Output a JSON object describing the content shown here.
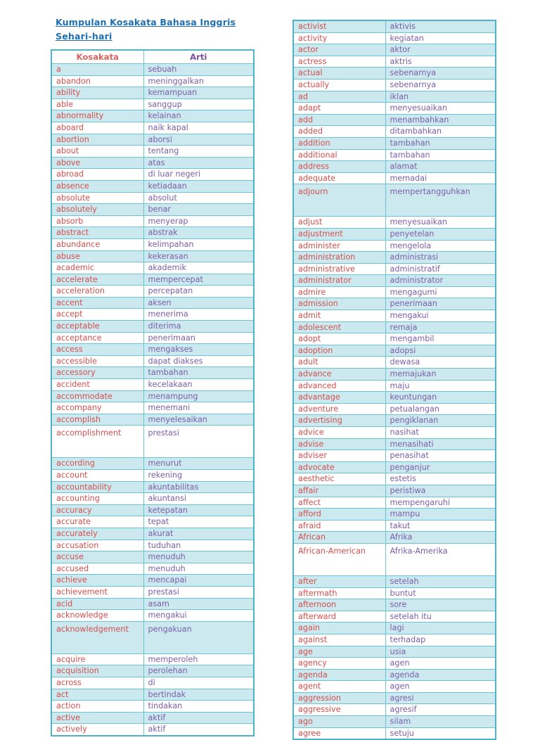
{
  "document": {
    "title_lines": [
      "Kumpulan Kosakata Bahasa Inggris ",
      "Sehari-hari "
    ],
    "title_color": "#1f6fb5"
  },
  "colors": {
    "border": "#6cc3d2",
    "outer_border": "#4fb3c4",
    "row_shade": "#cbe9ef",
    "row_plain": "#ffffff",
    "word_text": "#d4504f",
    "meaning_text": "#7b5fa8",
    "header_word": "#e0615e",
    "header_meaning": "#7a4f9e"
  },
  "left_table": {
    "headers": {
      "word": "Kosakata",
      "meaning": "Arti"
    },
    "rows": [
      {
        "word": "a",
        "meaning": "sebuah"
      },
      {
        "word": "abandon",
        "meaning": "meninggalkan"
      },
      {
        "word": "ability",
        "meaning": "kemampuan"
      },
      {
        "word": "able",
        "meaning": "sanggup"
      },
      {
        "word": "abnormality",
        "meaning": "kelainan"
      },
      {
        "word": "aboard",
        "meaning": "naik kapal"
      },
      {
        "word": "abortion",
        "meaning": "aborsi"
      },
      {
        "word": "about",
        "meaning": "tentang"
      },
      {
        "word": "above",
        "meaning": "atas"
      },
      {
        "word": "abroad",
        "meaning": "di luar negeri"
      },
      {
        "word": "absence",
        "meaning": "ketiadaan"
      },
      {
        "word": "absolute",
        "meaning": "absolut"
      },
      {
        "word": "absolutely",
        "meaning": "benar"
      },
      {
        "word": "absorb",
        "meaning": "menyerap"
      },
      {
        "word": "abstract",
        "meaning": "abstrak"
      },
      {
        "word": "abundance",
        "meaning": "kelimpahan"
      },
      {
        "word": "abuse",
        "meaning": "kekerasan"
      },
      {
        "word": "academic",
        "meaning": "akademik"
      },
      {
        "word": "accelerate",
        "meaning": "mempercepat"
      },
      {
        "word": "acceleration",
        "meaning": "percepatan"
      },
      {
        "word": "accent",
        "meaning": "aksen"
      },
      {
        "word": "accept",
        "meaning": "menerima"
      },
      {
        "word": "acceptable",
        "meaning": "diterima"
      },
      {
        "word": "acceptance",
        "meaning": "penerimaan"
      },
      {
        "word": "access",
        "meaning": "mengakses"
      },
      {
        "word": "accessible",
        "meaning": "dapat diakses"
      },
      {
        "word": "accessory",
        "meaning": "tambahan"
      },
      {
        "word": "accident",
        "meaning": "kecelakaan"
      },
      {
        "word": "accommodate",
        "meaning": "menampung"
      },
      {
        "word": "accompany",
        "meaning": "menemani"
      },
      {
        "word": "accomplish",
        "meaning": "menyelesaikan"
      },
      {
        "word": "accomplishment",
        "meaning": "prestasi",
        "tall": true
      },
      {
        "word": "according",
        "meaning": "menurut"
      },
      {
        "word": "account",
        "meaning": "rekening"
      },
      {
        "word": "accountability",
        "meaning": "akuntabilitas"
      },
      {
        "word": "accounting",
        "meaning": "akuntansi"
      },
      {
        "word": "accuracy",
        "meaning": "ketepatan"
      },
      {
        "word": "accurate",
        "meaning": "tepat"
      },
      {
        "word": "accurately",
        "meaning": "akurat"
      },
      {
        "word": "accusation",
        "meaning": "tuduhan"
      },
      {
        "word": "accuse",
        "meaning": "menuduh"
      },
      {
        "word": "accused",
        "meaning": "menuduh"
      },
      {
        "word": "achieve",
        "meaning": "mencapai"
      },
      {
        "word": "achievement",
        "meaning": "prestasi"
      },
      {
        "word": "acid",
        "meaning": "asam"
      },
      {
        "word": "acknowledge",
        "meaning": "mengakui"
      },
      {
        "word": "acknowledgement",
        "meaning": "pengakuan",
        "tall": true
      },
      {
        "word": "acquire",
        "meaning": "memperoleh"
      },
      {
        "word": "acquisition",
        "meaning": "perolehan"
      },
      {
        "word": "across",
        "meaning": "di"
      },
      {
        "word": "act",
        "meaning": "bertindak"
      },
      {
        "word": "action",
        "meaning": "tindakan"
      },
      {
        "word": "active",
        "meaning": "aktif"
      },
      {
        "word": "actively",
        "meaning": "aktif"
      }
    ]
  },
  "right_table": {
    "rows": [
      {
        "word": "activist",
        "meaning": "aktivis"
      },
      {
        "word": "activity",
        "meaning": "kegiatan"
      },
      {
        "word": "actor",
        "meaning": "aktor"
      },
      {
        "word": "actress",
        "meaning": "aktris"
      },
      {
        "word": "actual",
        "meaning": "sebenarnya"
      },
      {
        "word": "actually",
        "meaning": "sebenarnya"
      },
      {
        "word": "ad",
        "meaning": "iklan"
      },
      {
        "word": "adapt",
        "meaning": "menyesuaikan"
      },
      {
        "word": "add",
        "meaning": "menambahkan"
      },
      {
        "word": "added",
        "meaning": "ditambahkan"
      },
      {
        "word": "addition",
        "meaning": "tambahan"
      },
      {
        "word": "additional",
        "meaning": "tambahan"
      },
      {
        "word": "address",
        "meaning": "alamat"
      },
      {
        "word": "adequate",
        "meaning": "memadai"
      },
      {
        "word": "adjourn",
        "meaning": "mempertangguhkan",
        "tall": true
      },
      {
        "word": "adjust",
        "meaning": "menyesuaikan"
      },
      {
        "word": "adjustment",
        "meaning": "penyetelan"
      },
      {
        "word": "administer",
        "meaning": "mengelola"
      },
      {
        "word": "administration",
        "meaning": "administrasi"
      },
      {
        "word": "administrative",
        "meaning": "administratif"
      },
      {
        "word": "administrator",
        "meaning": "administrator"
      },
      {
        "word": "admire",
        "meaning": "mengagumi"
      },
      {
        "word": "admission",
        "meaning": "penerimaan"
      },
      {
        "word": "admit",
        "meaning": "mengakui"
      },
      {
        "word": "adolescent",
        "meaning": "remaja"
      },
      {
        "word": "adopt",
        "meaning": "mengambil"
      },
      {
        "word": "adoption",
        "meaning": "adopsi"
      },
      {
        "word": "adult",
        "meaning": "dewasa"
      },
      {
        "word": "advance",
        "meaning": "memajukan"
      },
      {
        "word": "advanced",
        "meaning": "maju"
      },
      {
        "word": "advantage",
        "meaning": "keuntungan"
      },
      {
        "word": "adventure",
        "meaning": "petualangan"
      },
      {
        "word": "advertising",
        "meaning": "pengiklanan"
      },
      {
        "word": "advice",
        "meaning": "nasihat"
      },
      {
        "word": "advise",
        "meaning": "menasihati"
      },
      {
        "word": "adviser",
        "meaning": "penasihat"
      },
      {
        "word": "advocate",
        "meaning": "penganjur"
      },
      {
        "word": "aesthetic",
        "meaning": "estetis"
      },
      {
        "word": "affair",
        "meaning": "peristiwa"
      },
      {
        "word": "affect",
        "meaning": "mempengaruhi"
      },
      {
        "word": "afford",
        "meaning": "mampu"
      },
      {
        "word": "afraid",
        "meaning": "takut"
      },
      {
        "word": "African",
        "meaning": "Afrika"
      },
      {
        "word": "African-American",
        "meaning": "Afrika-Amerika",
        "tall": true
      },
      {
        "word": "after",
        "meaning": "setelah"
      },
      {
        "word": "aftermath",
        "meaning": "buntut"
      },
      {
        "word": "afternoon",
        "meaning": "sore"
      },
      {
        "word": "afterward",
        "meaning": "setelah itu"
      },
      {
        "word": "again",
        "meaning": "lagi"
      },
      {
        "word": "against",
        "meaning": "terhadap"
      },
      {
        "word": "age",
        "meaning": "usia"
      },
      {
        "word": "agency",
        "meaning": "agen"
      },
      {
        "word": "agenda",
        "meaning": "agenda"
      },
      {
        "word": "agent",
        "meaning": "agen"
      },
      {
        "word": "aggression",
        "meaning": "agresi"
      },
      {
        "word": "aggressive",
        "meaning": "agresif"
      },
      {
        "word": "ago",
        "meaning": "silam"
      },
      {
        "word": "agree",
        "meaning": "setuju"
      }
    ]
  }
}
